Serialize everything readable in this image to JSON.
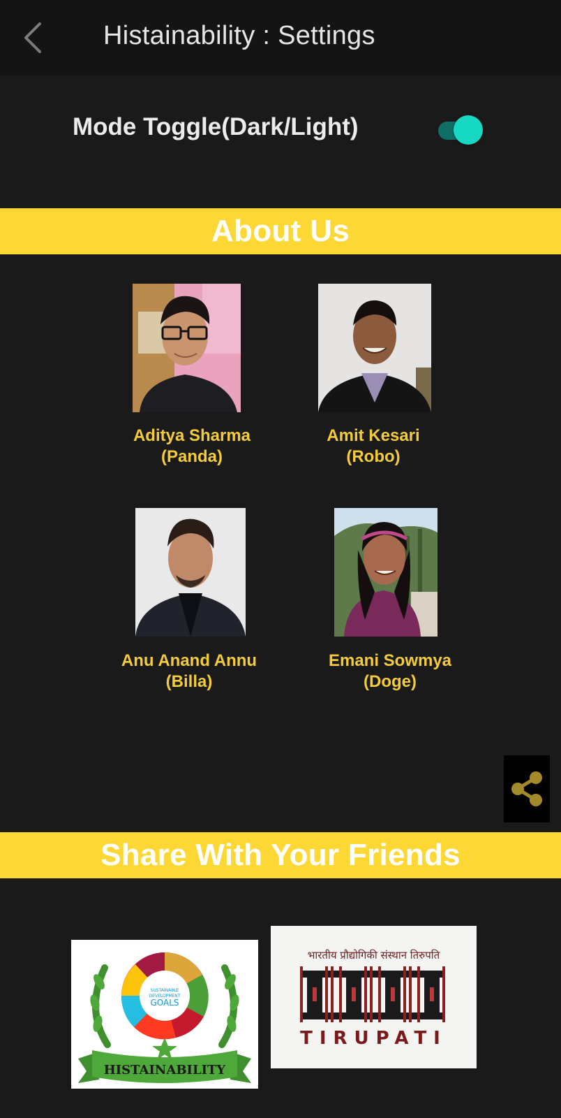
{
  "header": {
    "title": "Histainability : Settings",
    "back_icon": "chevron-left-icon"
  },
  "settings": {
    "mode_label": "Mode Toggle(Dark/Light)",
    "mode_toggle_on": true
  },
  "about": {
    "heading": "About Us",
    "members": [
      {
        "name": "Aditya Sharma",
        "nickname": "(Panda)"
      },
      {
        "name": "Amit Kesari",
        "nickname": "(Robo)"
      },
      {
        "name": "Anu Anand Annu",
        "nickname": "(Billa)"
      },
      {
        "name": "Emani Sowmya",
        "nickname": "(Doge)"
      }
    ]
  },
  "share": {
    "heading": "Share With Your Friends",
    "share_icon": "share-icon"
  },
  "logos": {
    "histainability_text": "HISTAINABILITY",
    "sdg_text": "SUSTAINABLE DEVELOPMENT GOALS",
    "iit_hindi": "भारतीय प्रौद्योगिकी संस्थान तिरुपति",
    "iit_text": "TIRUPATI"
  },
  "colors": {
    "background": "#1b1a1a",
    "topbar": "#141414",
    "banner": "#fdd835",
    "member_name": "#f4cc3a",
    "toggle_thumb": "#17d8c3",
    "toggle_track": "#0f6e66"
  }
}
